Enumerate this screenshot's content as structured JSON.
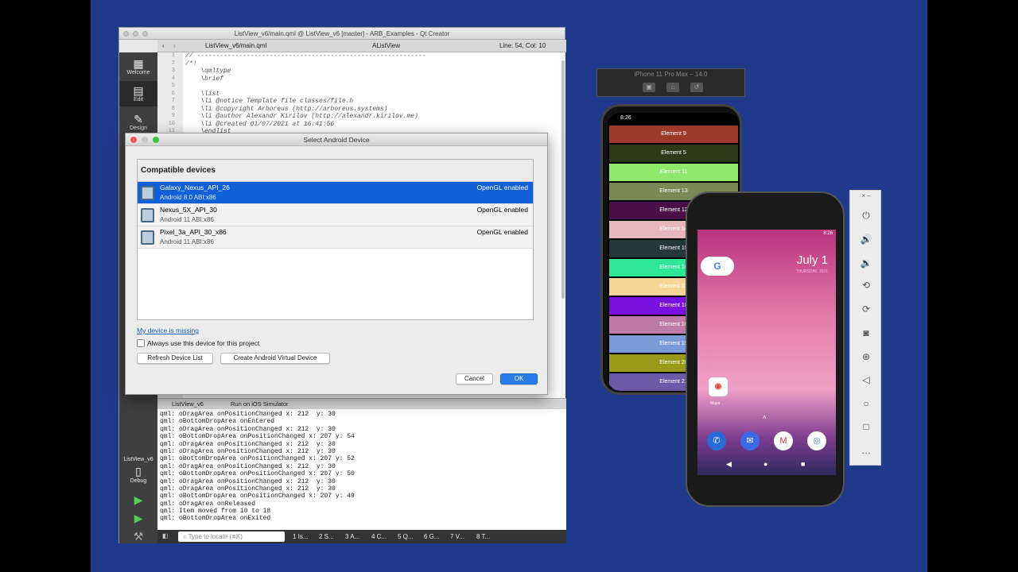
{
  "qt": {
    "title": "ListView_v6/main.qml @ ListView_v6 [master] - ARB_Examples - Qt Creator",
    "file": "ListView_v6/main.qml",
    "symbol": "AListView",
    "position": "Line: 54, Col: 10",
    "modes": [
      "Welcome",
      "Edit",
      "Design"
    ],
    "line_numbers": [
      "1",
      "2",
      "3",
      "4",
      "5",
      "6",
      "7",
      "8",
      "9",
      "10",
      "11"
    ],
    "code_lines": [
      "// ------------------------------------------------------------",
      "/*!",
      "    \\qmltype",
      "    \\brief",
      "",
      "    \\list",
      "    \\li @notice Template file classes/file.h",
      "    \\li @copyright Arboreus (http://arboreus.systems)",
      "    \\li @author Alexandr Kirilov (http://alexandr.kirilov.me)",
      "    \\li @created 01/07/2021 at 16:41:56",
      "    \\endlist"
    ],
    "output_tabs": [
      "ListView_v6",
      "Run on iOS Simulator"
    ],
    "output_lines": [
      "qml: oDragArea onPositionChanged x: 212  y: 30",
      "qml: oBottomDropArea onEntered",
      "qml: oDragArea onPositionChanged x: 212  y: 30",
      "qml: oBottomDropArea onPositionChanged x: 207 y: 54",
      "qml: oDragArea onPositionChanged x: 212  y: 30",
      "qml: oDragArea onPositionChanged x: 212  y: 30",
      "qml: oBottomDropArea onPositionChanged x: 207 y: 52",
      "qml: oDragArea onPositionChanged x: 212  y: 30",
      "qml: oBottomDropArea onPositionChanged x: 207 y: 50",
      "qml: oDragArea onPositionChanged x: 212  y: 30",
      "qml: oDragArea onPositionChanged x: 212  y: 30",
      "qml: oBottomDropArea onPositionChanged x: 207 y: 49",
      "qml: oDragArea onReleased",
      "qml: Item moved from 10 to 18",
      "qml: oBottomDropArea onExited"
    ],
    "locate_placeholder": "Type to locate (⌘K)",
    "panes": [
      "1 Is...",
      "2 S...",
      "3 A...",
      "4 C...",
      "5 Q...",
      "6 G...",
      "7 V...",
      "8 T..."
    ],
    "kit_label": "ListView_v6",
    "debug_label": "Debug"
  },
  "dialog": {
    "title": "Select Android Device",
    "header": "Compatible devices",
    "devices": [
      {
        "name": "Galaxy_Nexus_API_26",
        "sub": "Android 8.0  ABI:x86",
        "gl": "OpenGL enabled"
      },
      {
        "name": "Nexus_5X_API_30",
        "sub": "Android 11  ABI:x86",
        "gl": "OpenGL enabled"
      },
      {
        "name": "Pixel_3a_API_30_x86",
        "sub": "Android 11  ABI:x86",
        "gl": "OpenGL enabled"
      }
    ],
    "missing_link": "My device is missing",
    "always_use": "Always use this device for this project",
    "refresh": "Refresh Device List",
    "create_avd": "Create Android Virtual Device",
    "cancel": "Cancel",
    "ok": "OK"
  },
  "ios": {
    "title": "iPhone 11 Pro Max – 14.0",
    "time": "8:26",
    "rows": [
      {
        "label": "Element 9",
        "color": "#9c3a2c"
      },
      {
        "label": "Element 5",
        "color": "#2c3a1a"
      },
      {
        "label": "Element 11",
        "color": "#8ee86a"
      },
      {
        "label": "Element 13",
        "color": "#7a8a56"
      },
      {
        "label": "Element 12",
        "color": "#4a0f4a"
      },
      {
        "label": "Element 14",
        "color": "#e6b8bc"
      },
      {
        "label": "Element 15",
        "color": "#24383a"
      },
      {
        "label": "Element 16",
        "color": "#2ee898"
      },
      {
        "label": "Element 17",
        "color": "#f5d696"
      },
      {
        "label": "Element 18",
        "color": "#7a10e0"
      },
      {
        "label": "Element 10",
        "color": "#c07aa8"
      },
      {
        "label": "Element 19",
        "color": "#7a9ad8"
      },
      {
        "label": "Element 20",
        "color": "#9a9a1a"
      },
      {
        "label": "Element 21",
        "color": "#6a5aa8"
      }
    ]
  },
  "android": {
    "time": "8:26",
    "date": "July 1",
    "day": "THURSDAY, 2021",
    "maps_label": "Maps"
  }
}
